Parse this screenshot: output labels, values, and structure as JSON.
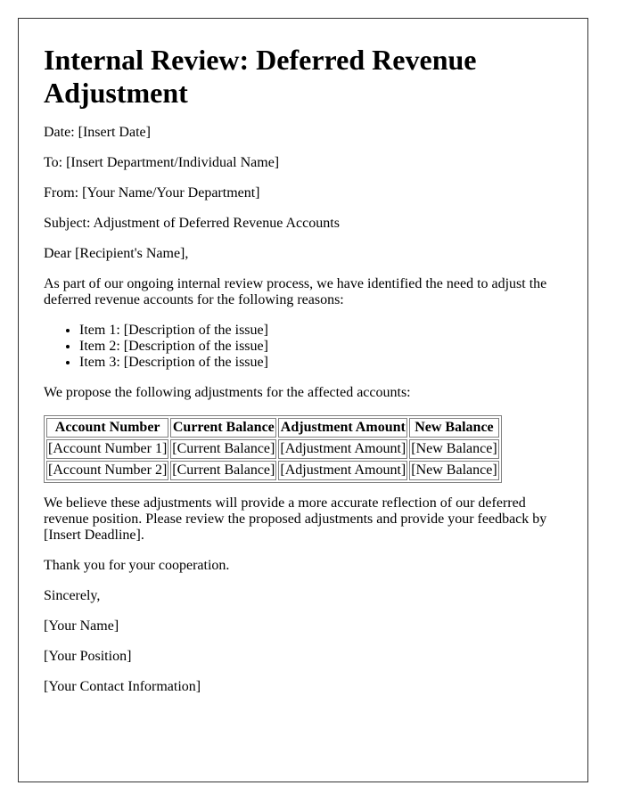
{
  "title": "Internal Review: Deferred Revenue Adjustment",
  "meta": {
    "date": "Date: [Insert Date]",
    "to": "To: [Insert Department/Individual Name]",
    "from": "From: [Your Name/Your Department]",
    "subject": "Subject: Adjustment of Deferred Revenue Accounts"
  },
  "salutation": "Dear [Recipient's Name],",
  "intro": "As part of our ongoing internal review process, we have identified the need to adjust the deferred revenue accounts for the following reasons:",
  "reasons": [
    "Item 1: [Description of the issue]",
    "Item 2: [Description of the issue]",
    "Item 3: [Description of the issue]"
  ],
  "proposal_intro": "We propose the following adjustments for the affected accounts:",
  "table": {
    "headers": [
      "Account Number",
      "Current Balance",
      "Adjustment Amount",
      "New Balance"
    ],
    "rows": [
      [
        "[Account Number 1]",
        "[Current Balance]",
        "[Adjustment Amount]",
        "[New Balance]"
      ],
      [
        "[Account Number 2]",
        "[Current Balance]",
        "[Adjustment Amount]",
        "[New Balance]"
      ]
    ]
  },
  "closing_paragraph": "We believe these adjustments will provide a more accurate reflection of our deferred revenue position. Please review the proposed adjustments and provide your feedback by [Insert Deadline].",
  "thanks": "Thank you for your cooperation.",
  "signoff": "Sincerely,",
  "signature": {
    "name": "[Your Name]",
    "position": "[Your Position]",
    "contact": "[Your Contact Information]"
  }
}
